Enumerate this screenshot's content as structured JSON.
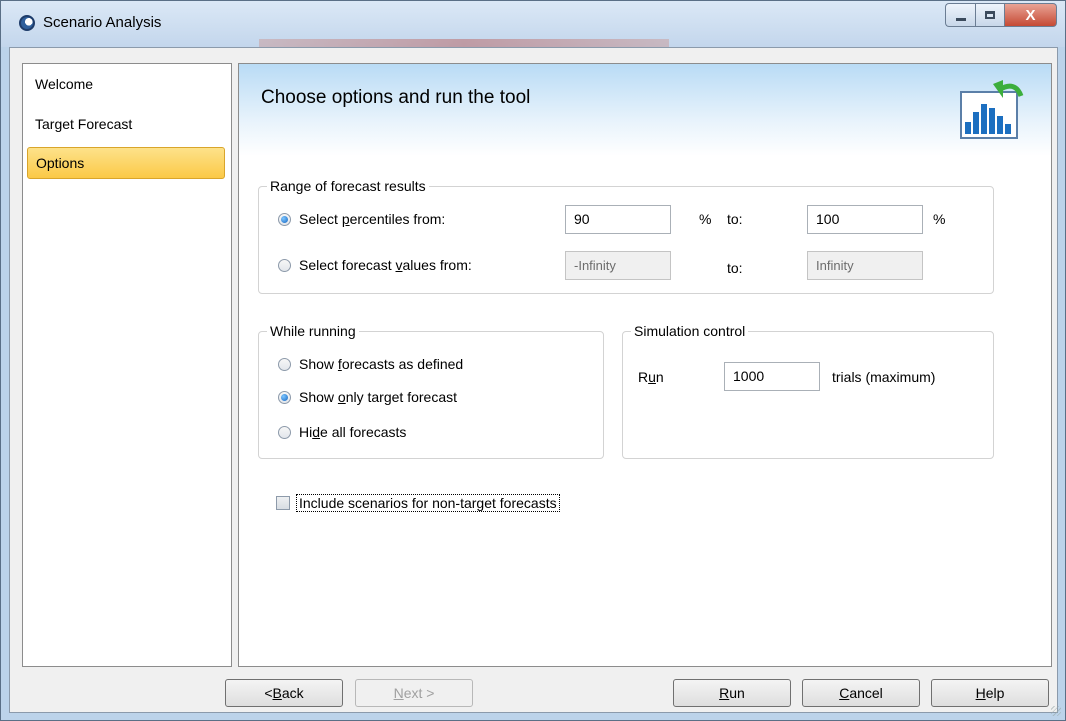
{
  "window": {
    "title": "Scenario Analysis",
    "close_glyph": "X"
  },
  "nav": {
    "items": [
      "Welcome",
      "Target Forecast",
      "Options"
    ],
    "selected": "Options"
  },
  "header": {
    "title": "Choose options and run the tool",
    "icon": "chart-refresh-icon"
  },
  "range": {
    "legend": "Range of forecast results",
    "percentiles": {
      "pre": "Select ",
      "u": "p",
      "post": "ercentiles from:",
      "from": "90",
      "pct1": "%",
      "to_label": "to:",
      "to": "100",
      "pct2": "%",
      "checked": true
    },
    "values": {
      "pre": "Select forecast ",
      "u": "v",
      "post": "alues from:",
      "from": "-Infinity",
      "to_label": "to:",
      "to": "Infinity",
      "checked": false
    }
  },
  "running": {
    "legend": "While running",
    "opt1": {
      "pre": "Show ",
      "u": "f",
      "post": "orecasts as defined",
      "checked": false
    },
    "opt2": {
      "pre": "Show ",
      "u": "o",
      "post": "nly target forecast",
      "checked": true
    },
    "opt3": {
      "pre": "Hi",
      "u": "d",
      "post": "e all forecasts",
      "checked": false
    }
  },
  "simulation": {
    "legend": "Simulation control",
    "run_pre": "R",
    "run_u": "u",
    "run_post": "n",
    "trials": "1000",
    "trials_label": "trials (maximum)"
  },
  "include": {
    "label": "Include scenarios for non-target forecasts",
    "checked": false
  },
  "buttons": {
    "back": {
      "pre": "< ",
      "u": "B",
      "post": "ack"
    },
    "next": {
      "pre": "",
      "u": "N",
      "post": "ext >"
    },
    "run": {
      "pre": "",
      "u": "R",
      "post": "un"
    },
    "cancel": {
      "pre": "",
      "u": "C",
      "post": "ancel"
    },
    "help": {
      "pre": "",
      "u": "H",
      "post": "elp"
    }
  },
  "colors": {
    "selected_nav": "#fbc947",
    "header_top": "#b9dbf5",
    "close_button": "#c54a34"
  }
}
